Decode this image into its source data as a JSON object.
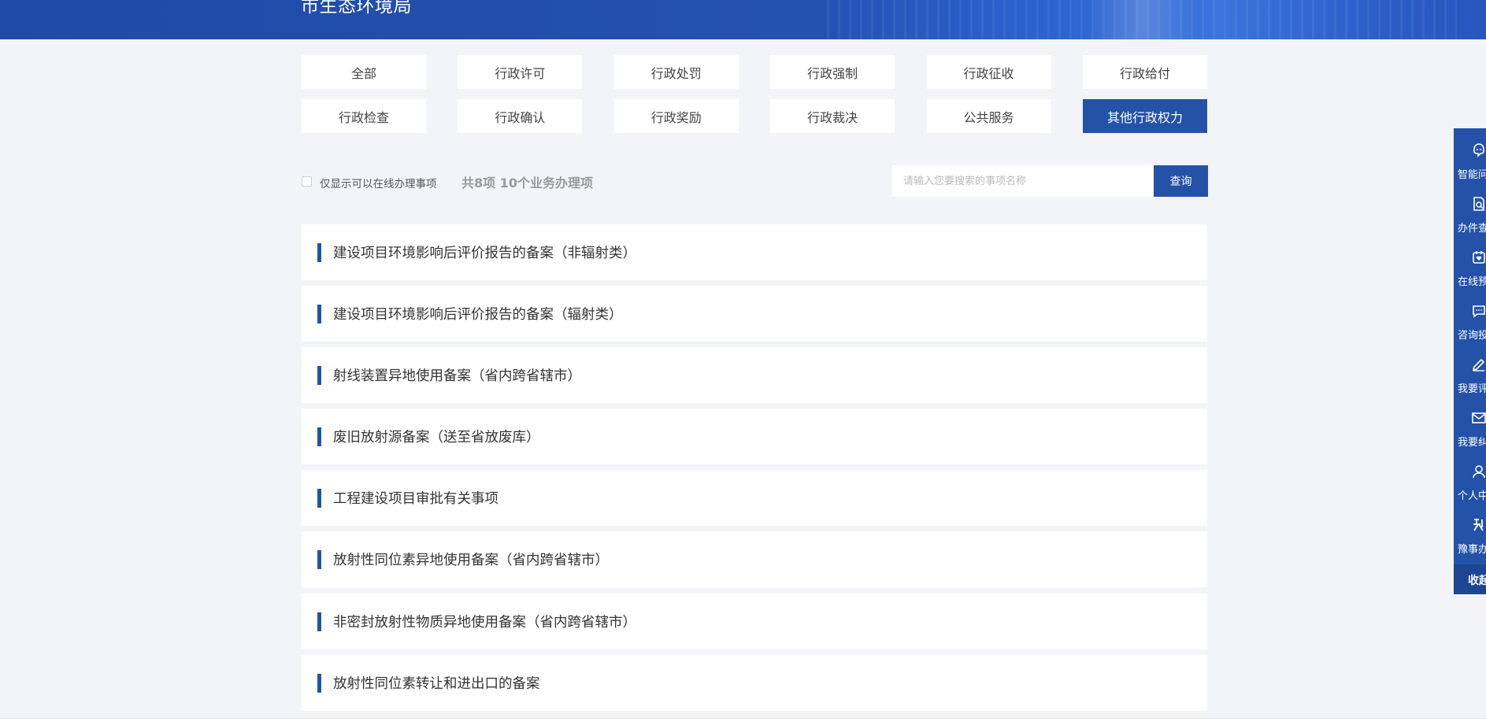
{
  "header": {
    "title": "市生态环境局"
  },
  "categories": [
    {
      "label": "全部",
      "active": false
    },
    {
      "label": "行政许可",
      "active": false
    },
    {
      "label": "行政处罚",
      "active": false
    },
    {
      "label": "行政强制",
      "active": false
    },
    {
      "label": "行政征收",
      "active": false
    },
    {
      "label": "行政给付",
      "active": false
    },
    {
      "label": "行政检查",
      "active": false
    },
    {
      "label": "行政确认",
      "active": false
    },
    {
      "label": "行政奖励",
      "active": false
    },
    {
      "label": "行政裁决",
      "active": false
    },
    {
      "label": "公共服务",
      "active": false
    },
    {
      "label": "其他行政权力",
      "active": true
    }
  ],
  "filter": {
    "online_only_label": "仅显示可以在线办理事项",
    "count_text": "共8项 10个业务办理项",
    "search_placeholder": "请输入您要搜索的事项名称",
    "search_button": "查询"
  },
  "items": [
    {
      "label": "建设项目环境影响后评价报告的备案（非辐射类）"
    },
    {
      "label": "建设项目环境影响后评价报告的备案（辐射类）"
    },
    {
      "label": "射线装置异地使用备案（省内跨省辖市）"
    },
    {
      "label": "废旧放射源备案（送至省放废库）"
    },
    {
      "label": "工程建设项目审批有关事项"
    },
    {
      "label": "放射性同位素异地使用备案（省内跨省辖市）"
    },
    {
      "label": "非密封放射性物质异地使用备案（省内跨省辖市）"
    },
    {
      "label": "放射性同位素转让和进出口的备案"
    }
  ],
  "sidebar": {
    "items": [
      {
        "label": "智能问",
        "icon": "robot-icon"
      },
      {
        "label": "办件查",
        "icon": "document-search-icon"
      },
      {
        "label": "在线预",
        "icon": "calendar-heart-icon"
      },
      {
        "label": "咨询投",
        "icon": "chat-bubble-icon"
      },
      {
        "label": "我要评",
        "icon": "edit-pencil-icon"
      },
      {
        "label": "我要纠",
        "icon": "mail-icon"
      },
      {
        "label": "个人中",
        "icon": "user-icon"
      },
      {
        "label": "豫事办",
        "icon": "app-logo-icon"
      }
    ],
    "collapse_label": "收起"
  },
  "colors": {
    "accent": "#2452a8",
    "page_background": "#f3f4f7"
  }
}
